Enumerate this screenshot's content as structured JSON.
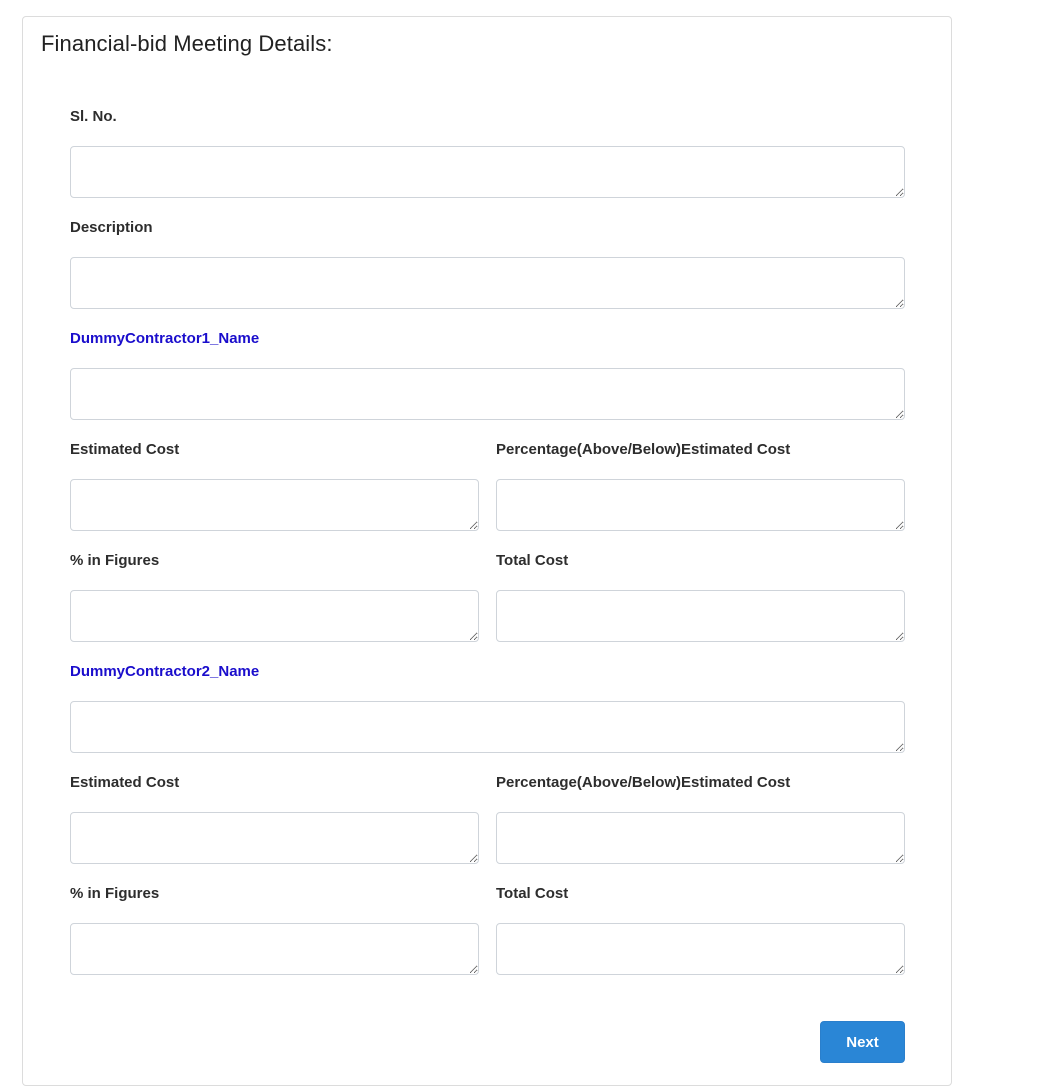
{
  "form": {
    "title": "Financial-bid Meeting Details:",
    "sl_no_label": "Sl. No.",
    "description_label": "Description",
    "contractor1": {
      "name": "DummyContractor1_Name",
      "estimated_cost_label": "Estimated Cost",
      "percentage_label": "Percentage(Above/Below)Estimated Cost",
      "percent_figures_label": "% in Figures",
      "total_cost_label": "Total Cost"
    },
    "contractor2": {
      "name": "DummyContractor2_Name",
      "estimated_cost_label": "Estimated Cost",
      "percentage_label": "Percentage(Above/Below)Estimated Cost",
      "percent_figures_label": "% in Figures",
      "total_cost_label": "Total Cost"
    },
    "next_label": "Next"
  },
  "colors": {
    "contractor_name": "#1a0dcc",
    "primary_button": "#2a86d6"
  }
}
